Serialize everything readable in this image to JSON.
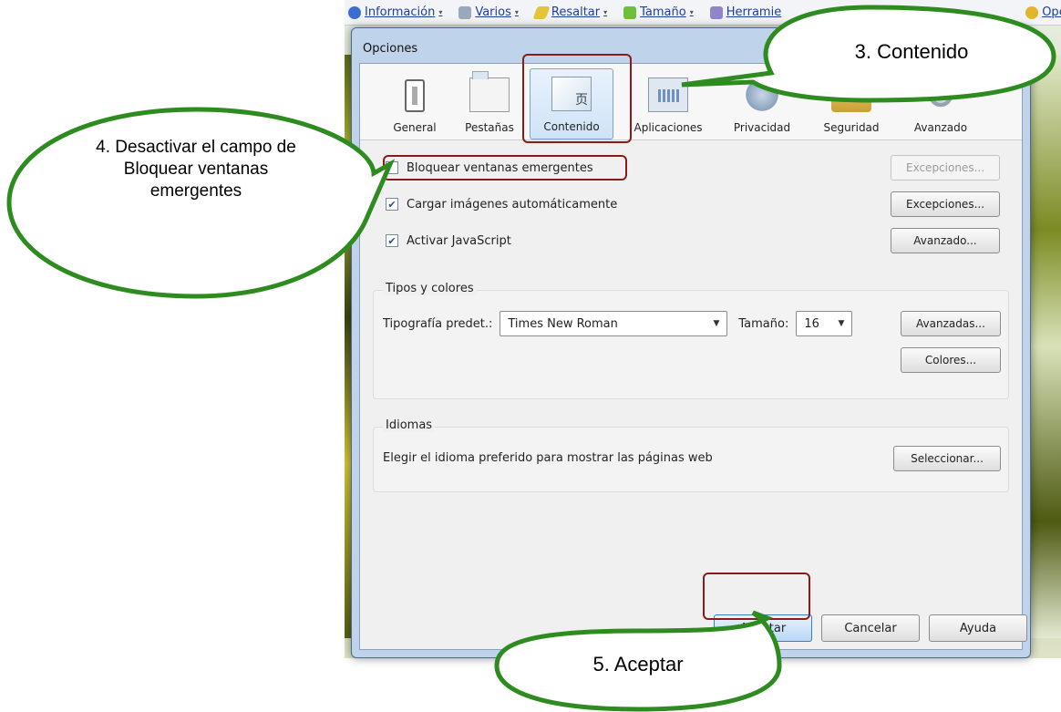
{
  "menubar": {
    "items": [
      "Información",
      "Varios",
      "Resaltar",
      "Tamaño",
      "Herramie",
      "Opcior"
    ]
  },
  "dialog": {
    "title": "Opciones",
    "tabs": [
      {
        "label": "General",
        "icon": "general-switch-icon"
      },
      {
        "label": "Pestañas",
        "icon": "tabs-window-icon"
      },
      {
        "label": "Contenido",
        "icon": "content-page-icon",
        "active": true
      },
      {
        "label": "Aplicaciones",
        "icon": "applications-icon"
      },
      {
        "label": "Privacidad",
        "icon": "privacy-mask-icon"
      },
      {
        "label": "Seguridad",
        "icon": "security-lock-icon"
      },
      {
        "label": "Avanzado",
        "icon": "advanced-gear-icon"
      }
    ],
    "content": {
      "block_popups": {
        "label": "Bloquear ventanas emergentes",
        "checked": false,
        "button": "Excepciones..."
      },
      "load_images": {
        "label": "Cargar imágenes automáticamente",
        "checked": true,
        "button": "Excepciones..."
      },
      "javascript": {
        "label": "Activar JavaScript",
        "checked": true,
        "button": "Avanzado..."
      }
    },
    "fonts": {
      "legend": "Tipos y colores",
      "font_label": "Tipografía predet.:",
      "font_value": "Times New Roman",
      "size_label": "Tamaño:",
      "size_value": "16",
      "advanced_button": "Avanzadas...",
      "colors_button": "Colores..."
    },
    "languages": {
      "legend": "Idiomas",
      "text": "Elegir el idioma preferido para mostrar las páginas web",
      "button": "Seleccionar..."
    },
    "footer": {
      "ok": "Aceptar",
      "cancel": "Cancelar",
      "help": "Ayuda"
    }
  },
  "callouts": {
    "contenido": "3. Contenido",
    "desactivar": "4. Desactivar el campo de Bloquear ventanas emergentes",
    "aceptar": "5. Aceptar"
  },
  "colors": {
    "callout_border": "#2e8b1f",
    "highlight": "#8b1a1a"
  }
}
